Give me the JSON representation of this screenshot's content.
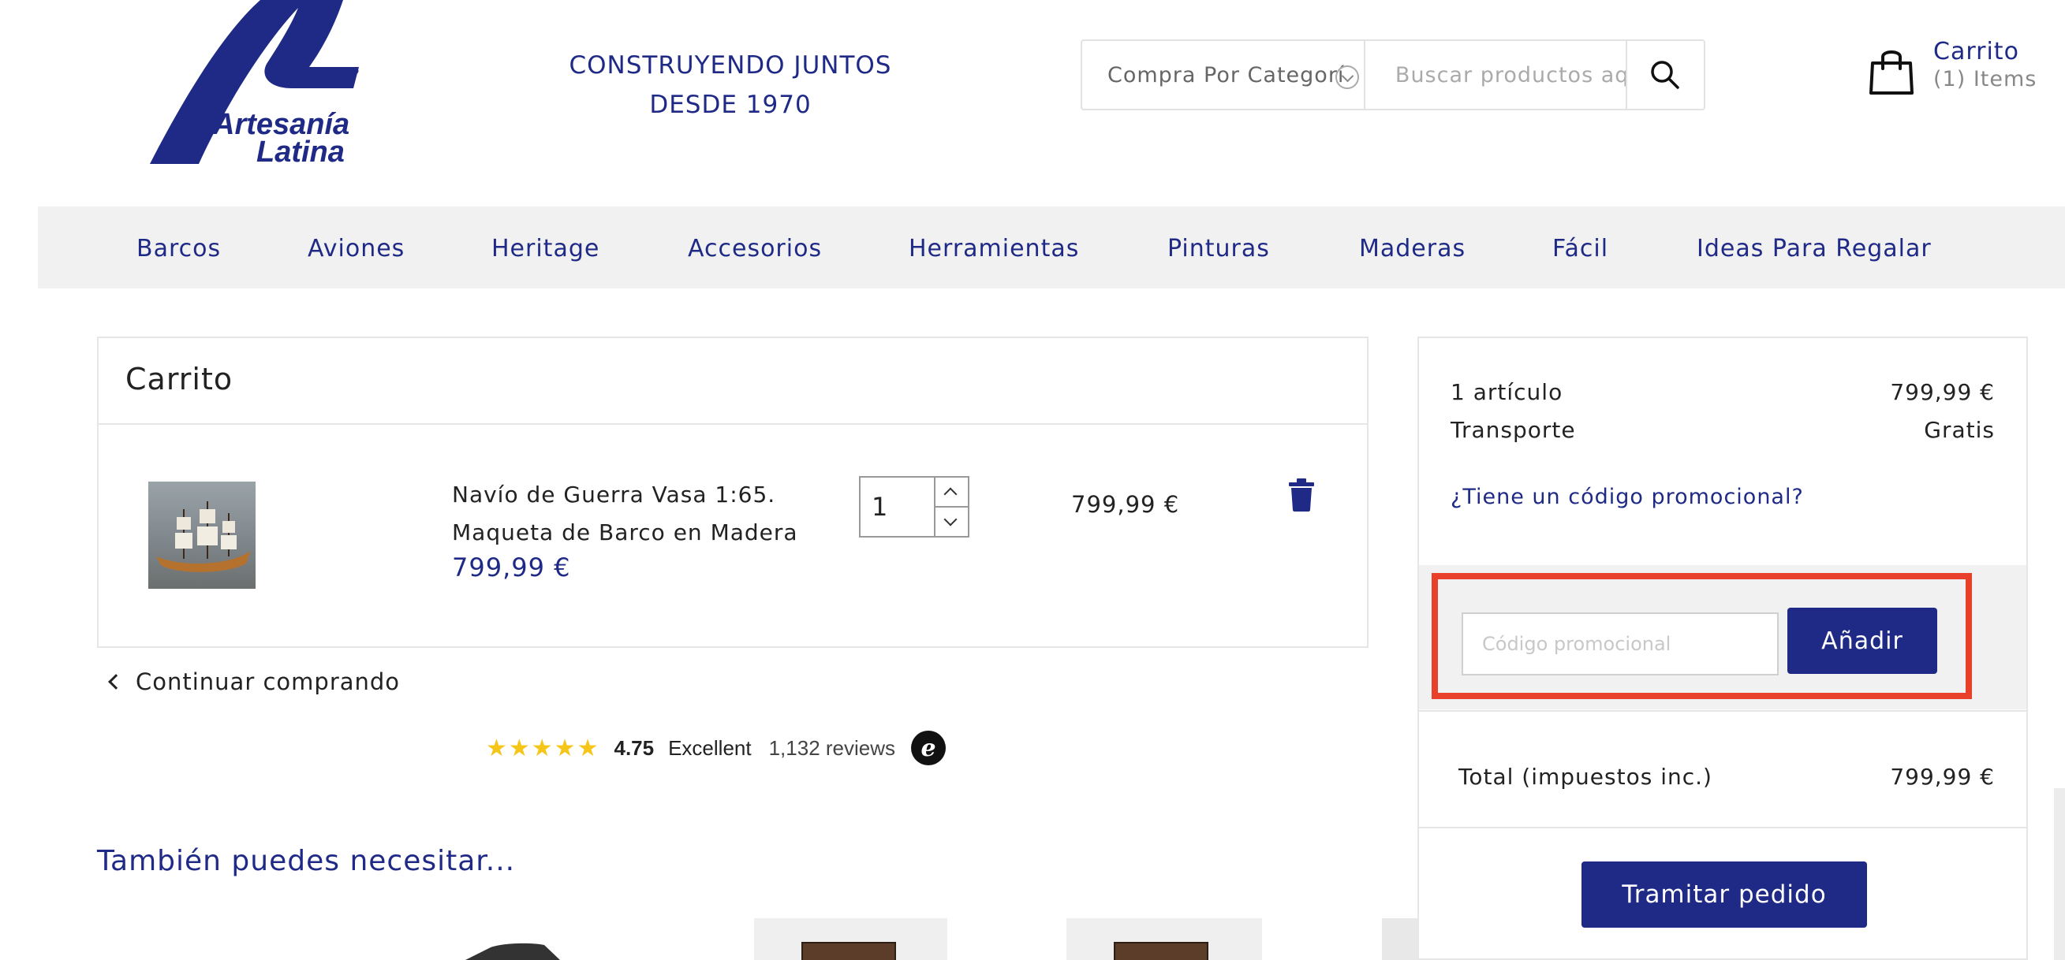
{
  "header": {
    "logo_text_line1": "Artesanía",
    "logo_text_line2": "Latina",
    "tagline_line1": "CONSTRUYENDO JUNTOS",
    "tagline_line2": "DESDE 1970",
    "search": {
      "category_label": "Compra Por Categoría",
      "placeholder": "Buscar productos aquí"
    },
    "cart": {
      "label": "Carrito",
      "count": "(1) Items"
    }
  },
  "nav": {
    "items": [
      "Barcos",
      "Aviones",
      "Heritage",
      "Accesorios",
      "Herramientas",
      "Pinturas",
      "Maderas",
      "Fácil",
      "Ideas Para Regalar"
    ]
  },
  "cart": {
    "title": "Carrito",
    "item": {
      "name_line1": "Navío de Guerra Vasa 1:65.",
      "name_line2": "Maqueta de Barco en Madera",
      "price": "799,99 €",
      "quantity": "1",
      "line_total": "799,99 €"
    },
    "continue_label": "Continuar comprando"
  },
  "reviews": {
    "stars": "★★★★★",
    "rating": "4.75",
    "label": "Excellent",
    "count": "1,132 reviews",
    "badge": "e"
  },
  "recommendations": {
    "title": "También puedes necesitar..."
  },
  "summary": {
    "items_label": "1 artículo",
    "items_value": "799,99 €",
    "shipping_label": "Transporte",
    "shipping_value": "Gratis",
    "promo_link": "¿Tiene un código promocional?",
    "promo_placeholder": "Código promocional",
    "promo_button": "Añadir",
    "total_label": "Total (impuestos inc.)",
    "total_value": "799,99 €",
    "checkout_button": "Tramitar pedido"
  },
  "colors": {
    "brand_blue": "#1f2a87",
    "highlight_red": "#e8402a",
    "star_yellow": "#f5c518"
  }
}
